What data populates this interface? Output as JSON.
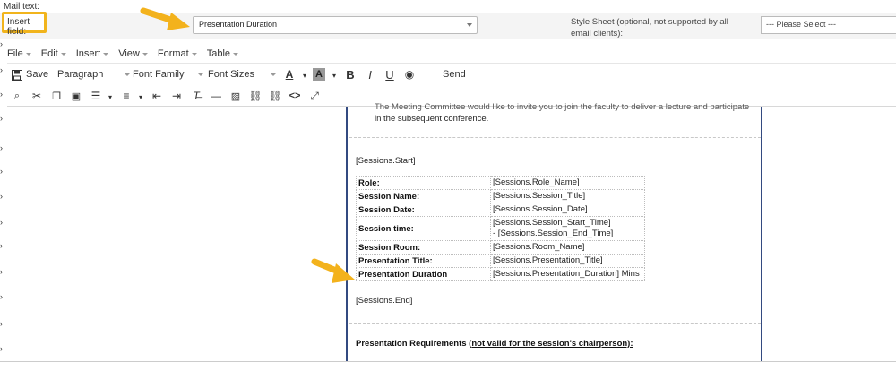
{
  "mail_text_label": "Mail text:",
  "insert_field": {
    "label": "Insert field:",
    "selected": "Presentation Duration"
  },
  "style_sheet": {
    "label": "Style Sheet (optional, not supported by all email clients):",
    "selected": "--- Please Select ---"
  },
  "menubar": [
    "File",
    "Edit",
    "Insert",
    "View",
    "Format",
    "Table"
  ],
  "toolbar1": {
    "save": "Save",
    "paragraph": "Paragraph",
    "font_family": "Font Family",
    "font_sizes": "Font Sizes",
    "send": "Send"
  },
  "document": {
    "intro_line1": "The Meeting Committee would like to invite you to join the faculty to deliver a lecture and participate",
    "intro_line2": "in the subsequent conference.",
    "sessions_start": "[Sessions.Start]",
    "sessions_end": "[Sessions.End]",
    "rows": [
      {
        "key": "Role:",
        "value": "[Sessions.Role_Name]"
      },
      {
        "key": "Session Name:",
        "value": "[Sessions.Session_Title]"
      },
      {
        "key": "Session Date:",
        "value": "[Sessions.Session_Date]"
      },
      {
        "key": "Session time:",
        "value": "[Sessions.Session_Start_Time]",
        "value2": "- [Sessions.Session_End_Time]"
      },
      {
        "key": "Session Room:",
        "value": "[Sessions.Room_Name]"
      },
      {
        "key": "Presentation Title:",
        "value": "[Sessions.Presentation_Title]"
      },
      {
        "key": "Presentation Duration",
        "value": "[Sessions.Presentation_Duration] Mins"
      }
    ],
    "requirements_prefix": "Presentation Requirements (",
    "requirements_underlined": "not valid for the session's chairperson):"
  },
  "colors": {
    "highlight": "#f1b41c",
    "arrow": "#f3b21c",
    "page_border": "#334a80"
  }
}
